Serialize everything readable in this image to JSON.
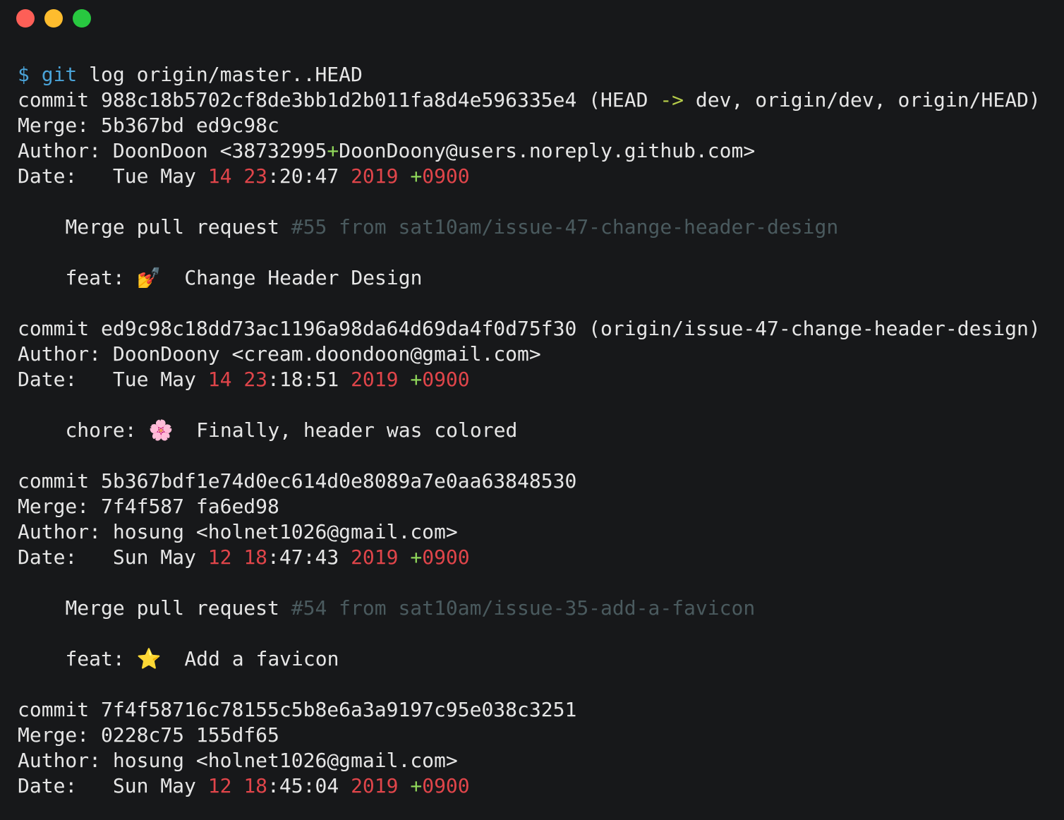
{
  "window": {
    "controls": [
      "close",
      "minimize",
      "maximize"
    ]
  },
  "prompt": {
    "symbol": "$",
    "command": "git",
    "args": "log origin/master..HEAD"
  },
  "commits": [
    {
      "commit_label": "commit",
      "hash": "988c18b5702cf8de3bb1d2b011fa8d4e596335e4",
      "refs_open": "(HEAD",
      "refs_arrow": "->",
      "refs_rest": "dev, origin/dev, origin/HEAD)",
      "merge_label": "Merge:",
      "merge": "5b367bd ed9c98c",
      "author_label": "Author:",
      "author_name": "DoonDoon",
      "author_email_pre": "<38732995",
      "author_email_plus": "+",
      "author_email_post": "DoonDoony@users.noreply.github.com>",
      "date_label": "Date:",
      "date_day": "Tue May",
      "date_dd": "14",
      "date_hh": "23",
      "date_rest": ":20:47",
      "date_year": "2019",
      "date_tz_plus": "+",
      "date_tz": "0900",
      "messages": [
        {
          "plain": "Merge pull request",
          "dim": "#55 from sat10am/issue-47-change-header-design"
        },
        {
          "plain": "feat:",
          "emoji": "💅",
          "text": "Change Header Design"
        }
      ]
    },
    {
      "commit_label": "commit",
      "hash": "ed9c98c18dd73ac1196a98da64d69da4f0d75f30",
      "refs_open": "(origin/issue-47-change-header-design)",
      "author_label": "Author:",
      "author_name": "DoonDoony",
      "author_email": "<cream.doondoon@gmail.com>",
      "date_label": "Date:",
      "date_day": "Tue May",
      "date_dd": "14",
      "date_hh": "23",
      "date_rest": ":18:51",
      "date_year": "2019",
      "date_tz_plus": "+",
      "date_tz": "0900",
      "messages": [
        {
          "plain": "chore:",
          "emoji": "🌸",
          "text": "Finally, header was colored"
        }
      ]
    },
    {
      "commit_label": "commit",
      "hash": "5b367bdf1e74d0ec614d0e8089a7e0aa63848530",
      "merge_label": "Merge:",
      "merge": "7f4f587 fa6ed98",
      "author_label": "Author:",
      "author_name": "hosung",
      "author_email": "<holnet1026@gmail.com>",
      "date_label": "Date:",
      "date_day": "Sun May",
      "date_dd": "12",
      "date_hh": "18",
      "date_rest": ":47:43",
      "date_year": "2019",
      "date_tz_plus": "+",
      "date_tz": "0900",
      "messages": [
        {
          "plain": "Merge pull request",
          "dim": "#54 from sat10am/issue-35-add-a-favicon"
        },
        {
          "plain": "feat:",
          "emoji": "⭐",
          "text": "Add a favicon"
        }
      ]
    },
    {
      "commit_label": "commit",
      "hash": "7f4f58716c78155c5b8e6a3a9197c95e038c3251",
      "merge_label": "Merge:",
      "merge": "0228c75 155df65",
      "author_label": "Author:",
      "author_name": "hosung",
      "author_email": "<holnet1026@gmail.com>",
      "date_label": "Date:",
      "date_day": "Sun May",
      "date_dd": "12",
      "date_hh": "18",
      "date_rest": ":45:04",
      "date_year": "2019",
      "date_tz_plus": "+",
      "date_tz": "0900"
    }
  ]
}
